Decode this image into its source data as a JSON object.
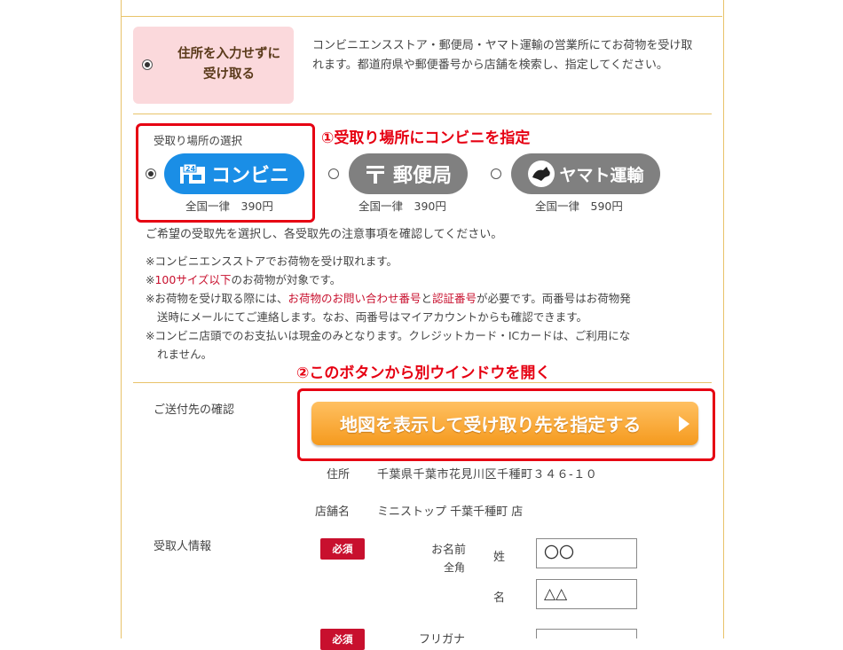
{
  "no_address": {
    "label_line1": "住所を入力せずに",
    "label_line2": "受け取る",
    "description": "コンビニエンスストア・郵便局・ヤマト運輸の営業所にてお荷物を受け取れます。都道府県や郵便番号から店舗を検索し、指定してください。"
  },
  "pickup": {
    "section_label": "受取り場所の選択",
    "annotation1": "①受取り場所にコンビニを指定",
    "options": [
      {
        "label": "コンビニ",
        "price": "全国一律　390円",
        "selected": true,
        "color": "#1a8ee6",
        "icon": "convenience-store-icon"
      },
      {
        "label": "郵便局",
        "price": "全国一律　390円",
        "selected": false,
        "color": "#808080",
        "icon": "post-office-icon"
      },
      {
        "label": "ヤマト運輸",
        "price": "全国一律　590円",
        "selected": false,
        "color": "#808080",
        "icon": "black-cat-icon"
      }
    ],
    "instruction": "ご希望の受取先を選択し、各受取先の注意事項を確認してください。",
    "notes": {
      "n1": "※コンビニエンスストアでお荷物を受け取れます。",
      "n2_prefix": "※",
      "n2_red": "100サイズ以下",
      "n2_suffix": "のお荷物が対象です。",
      "n3_a": "※お荷物を受け取る際には、",
      "n3_red1": "お荷物のお問い合わせ番号",
      "n3_b": "と",
      "n3_red2": "認証番号",
      "n3_c": "が必要です。両番号はお荷物発",
      "n3_line2": "送時にメールにてご連絡します。なお、両番号はマイアカウントからも確認できます。",
      "n4_line1": "※コンビニ店頭でのお支払いは現金のみとなります。クレジットカード・ICカードは、ご利用にな",
      "n4_line2": "れません。"
    }
  },
  "annotation2": "②このボタンから別ウインドウを開く",
  "destination": {
    "section_label": "ご送付先の確認",
    "map_button": "地図を表示して受け取り先を指定する",
    "address_label": "住所",
    "address_value": "千葉県千葉市花見川区千種町３４６-１０",
    "store_label": "店舗名",
    "store_value": "ミニストップ 千葉千種町 店"
  },
  "recipient": {
    "section_label": "受取人情報",
    "required": "必須",
    "name_label": "お名前",
    "fullwidth": "全角",
    "last_label": "姓",
    "last_value": "〇〇",
    "first_label": "名",
    "first_value": "△△",
    "required2": "必須",
    "furigana_label": "フリガナ"
  },
  "colors": {
    "accent_red": "#e60012",
    "border_gold": "#e8c36a",
    "cta_orange": "#f59a1e"
  }
}
